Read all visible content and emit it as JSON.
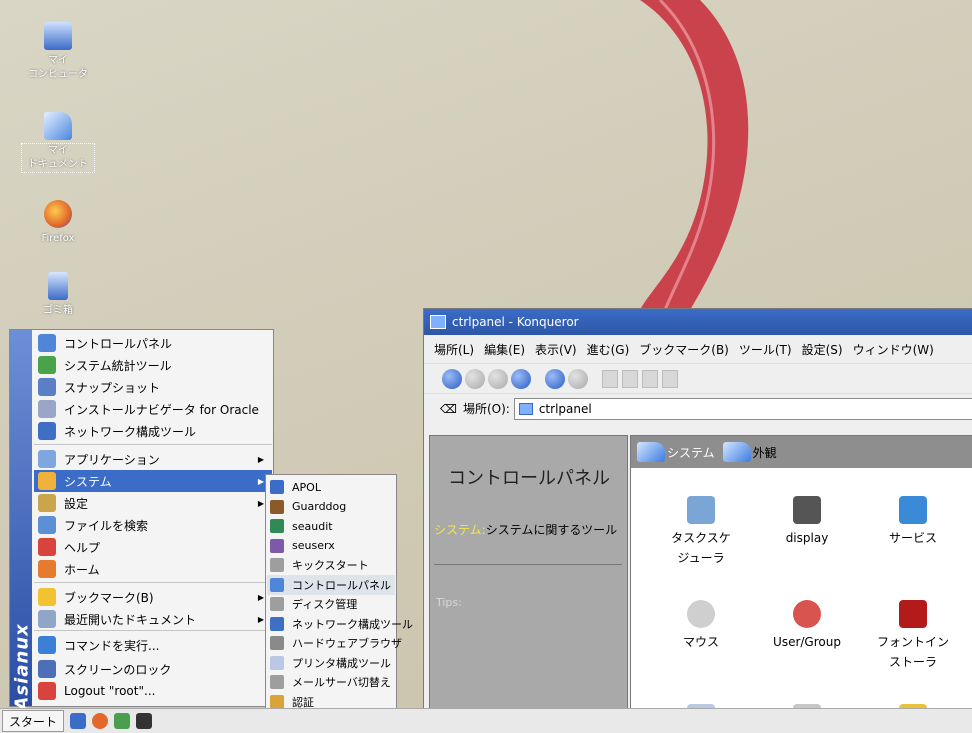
{
  "desktop": {
    "icons": [
      {
        "label_line1": "マイ",
        "label_line2": "コンピュータ"
      },
      {
        "label_line1": "マイ",
        "label_line2": "ドキュメント"
      },
      {
        "label_line1": "Firefox",
        "label_line2": ""
      },
      {
        "label_line1": "ゴミ箱",
        "label_line2": ""
      }
    ]
  },
  "window": {
    "title": "ctrlpanel - Konqueror",
    "menus": [
      "場所(L)",
      "編集(E)",
      "表示(V)",
      "進む(G)",
      "ブックマーク(B)",
      "ツール(T)",
      "設定(S)",
      "ウィンドウ(W)"
    ],
    "location_label": "場所(O):",
    "location_value": "ctrlpanel",
    "left_pane": {
      "title": "コントロールパネル",
      "desc_highlight": "システム:",
      "desc_text": "システムに関するツール",
      "tips": "Tips:"
    },
    "tabs": [
      {
        "label": "システム"
      },
      {
        "label": "外観"
      }
    ],
    "grid": [
      {
        "label": "タスクスケジューラ",
        "icon": "scheduler-icon",
        "color": "#7aa6d6"
      },
      {
        "label": "display",
        "icon": "display-icon",
        "color": "#555555"
      },
      {
        "label": "サービス",
        "icon": "services-icon",
        "color": "#3b8ad8"
      },
      {
        "label": "マウス",
        "icon": "mouse-icon",
        "color": "#cfcfcf"
      },
      {
        "label": "User/Group",
        "icon": "users-icon",
        "color": "#d9534f"
      },
      {
        "label": "フォントインストーラ",
        "icon": "font-installer-icon",
        "color": "#b31b1b"
      },
      {
        "label": "",
        "icon": "printer-icon",
        "color": "#b9c9e4"
      },
      {
        "label": "",
        "icon": "network-icon",
        "color": "#c7c7c7"
      },
      {
        "label": "",
        "icon": "security-warning-icon",
        "color": "#e8c33a"
      }
    ]
  },
  "kmenu": {
    "brand": "Asianux",
    "items": [
      {
        "label": "コントロールパネル",
        "icon": "control-panel-icon",
        "color": "#4f86d8",
        "arrow": ""
      },
      {
        "label": "システム統計ツール",
        "icon": "stats-icon",
        "color": "#49a34a",
        "arrow": ""
      },
      {
        "label": "スナップショット",
        "icon": "snapshot-icon",
        "color": "#5b7fc7",
        "arrow": ""
      },
      {
        "label": "インストールナビゲータ for Oracle",
        "icon": "install-navigator-icon",
        "color": "#9aa5c8",
        "arrow": ""
      },
      {
        "label": "ネットワーク構成ツール",
        "icon": "network-config-icon",
        "color": "#3d6fc4",
        "arrow": ""
      },
      {
        "label": "アプリケーション",
        "icon": "applications-icon",
        "color": "#7fa6df",
        "arrow": "▶"
      },
      {
        "label": "システム",
        "icon": "system-icon",
        "color": "#f0b23a",
        "arrow": "▶"
      },
      {
        "label": "設定",
        "icon": "settings-icon",
        "color": "#c9a64b",
        "arrow": "▶"
      },
      {
        "label": "ファイルを検索",
        "icon": "find-file-icon",
        "color": "#5d8fd4",
        "arrow": ""
      },
      {
        "label": "ヘルプ",
        "icon": "help-icon",
        "color": "#d8443b",
        "arrow": ""
      },
      {
        "label": "ホーム",
        "icon": "home-icon",
        "color": "#e47b2e",
        "arrow": ""
      },
      {
        "label": "ブックマーク(B)",
        "icon": "bookmark-icon",
        "color": "#f1c232",
        "arrow": "▶"
      },
      {
        "label": "最近開いたドキュメント",
        "icon": "recent-docs-icon",
        "color": "#8fa6c9",
        "arrow": "▶"
      },
      {
        "label": "コマンドを実行...",
        "icon": "run-command-icon",
        "color": "#3b7fd6",
        "arrow": ""
      },
      {
        "label": "スクリーンのロック",
        "icon": "lock-icon",
        "color": "#4d6fb8",
        "arrow": ""
      },
      {
        "label": "Logout \"root\"...",
        "icon": "logout-icon",
        "color": "#d8443b",
        "arrow": ""
      }
    ]
  },
  "submenu": {
    "items": [
      {
        "label": "APOL",
        "icon": "apol-icon",
        "color": "#3b6cc7"
      },
      {
        "label": "Guarddog",
        "icon": "guarddog-icon",
        "color": "#8b5a2b"
      },
      {
        "label": "seaudit",
        "icon": "seaudit-icon",
        "color": "#2e8b57"
      },
      {
        "label": "seuserx",
        "icon": "seuserx-icon",
        "color": "#7d5aa8"
      },
      {
        "label": "キックスタート",
        "icon": "kickstart-icon",
        "color": "#9e9e9e"
      },
      {
        "label": "コントロールパネル",
        "icon": "control-panel-icon",
        "color": "#4f86d8"
      },
      {
        "label": "ディスク管理",
        "icon": "disk-icon",
        "color": "#9e9e9e"
      },
      {
        "label": "ネットワーク構成ツール",
        "icon": "network-config-icon",
        "color": "#3d6fc4"
      },
      {
        "label": "ハードウェアブラウザ",
        "icon": "hardware-icon",
        "color": "#8a8a8a"
      },
      {
        "label": "プリンタ構成ツール",
        "icon": "printer-icon",
        "color": "#b9c9e4"
      },
      {
        "label": "メールサーバ切替え",
        "icon": "mail-icon",
        "color": "#9e9e9e"
      },
      {
        "label": "認証",
        "icon": "auth-icon",
        "color": "#d9a33a"
      }
    ]
  },
  "taskbar": {
    "start_label": "スタート",
    "quick_launch": [
      {
        "icon": "desktop-icon",
        "color": "#3b6cc7"
      },
      {
        "icon": "firefox-icon",
        "color": "#e2682b"
      },
      {
        "icon": "network-icon",
        "color": "#4b9e4b"
      },
      {
        "icon": "terminal-icon",
        "color": "#333333"
      }
    ]
  }
}
